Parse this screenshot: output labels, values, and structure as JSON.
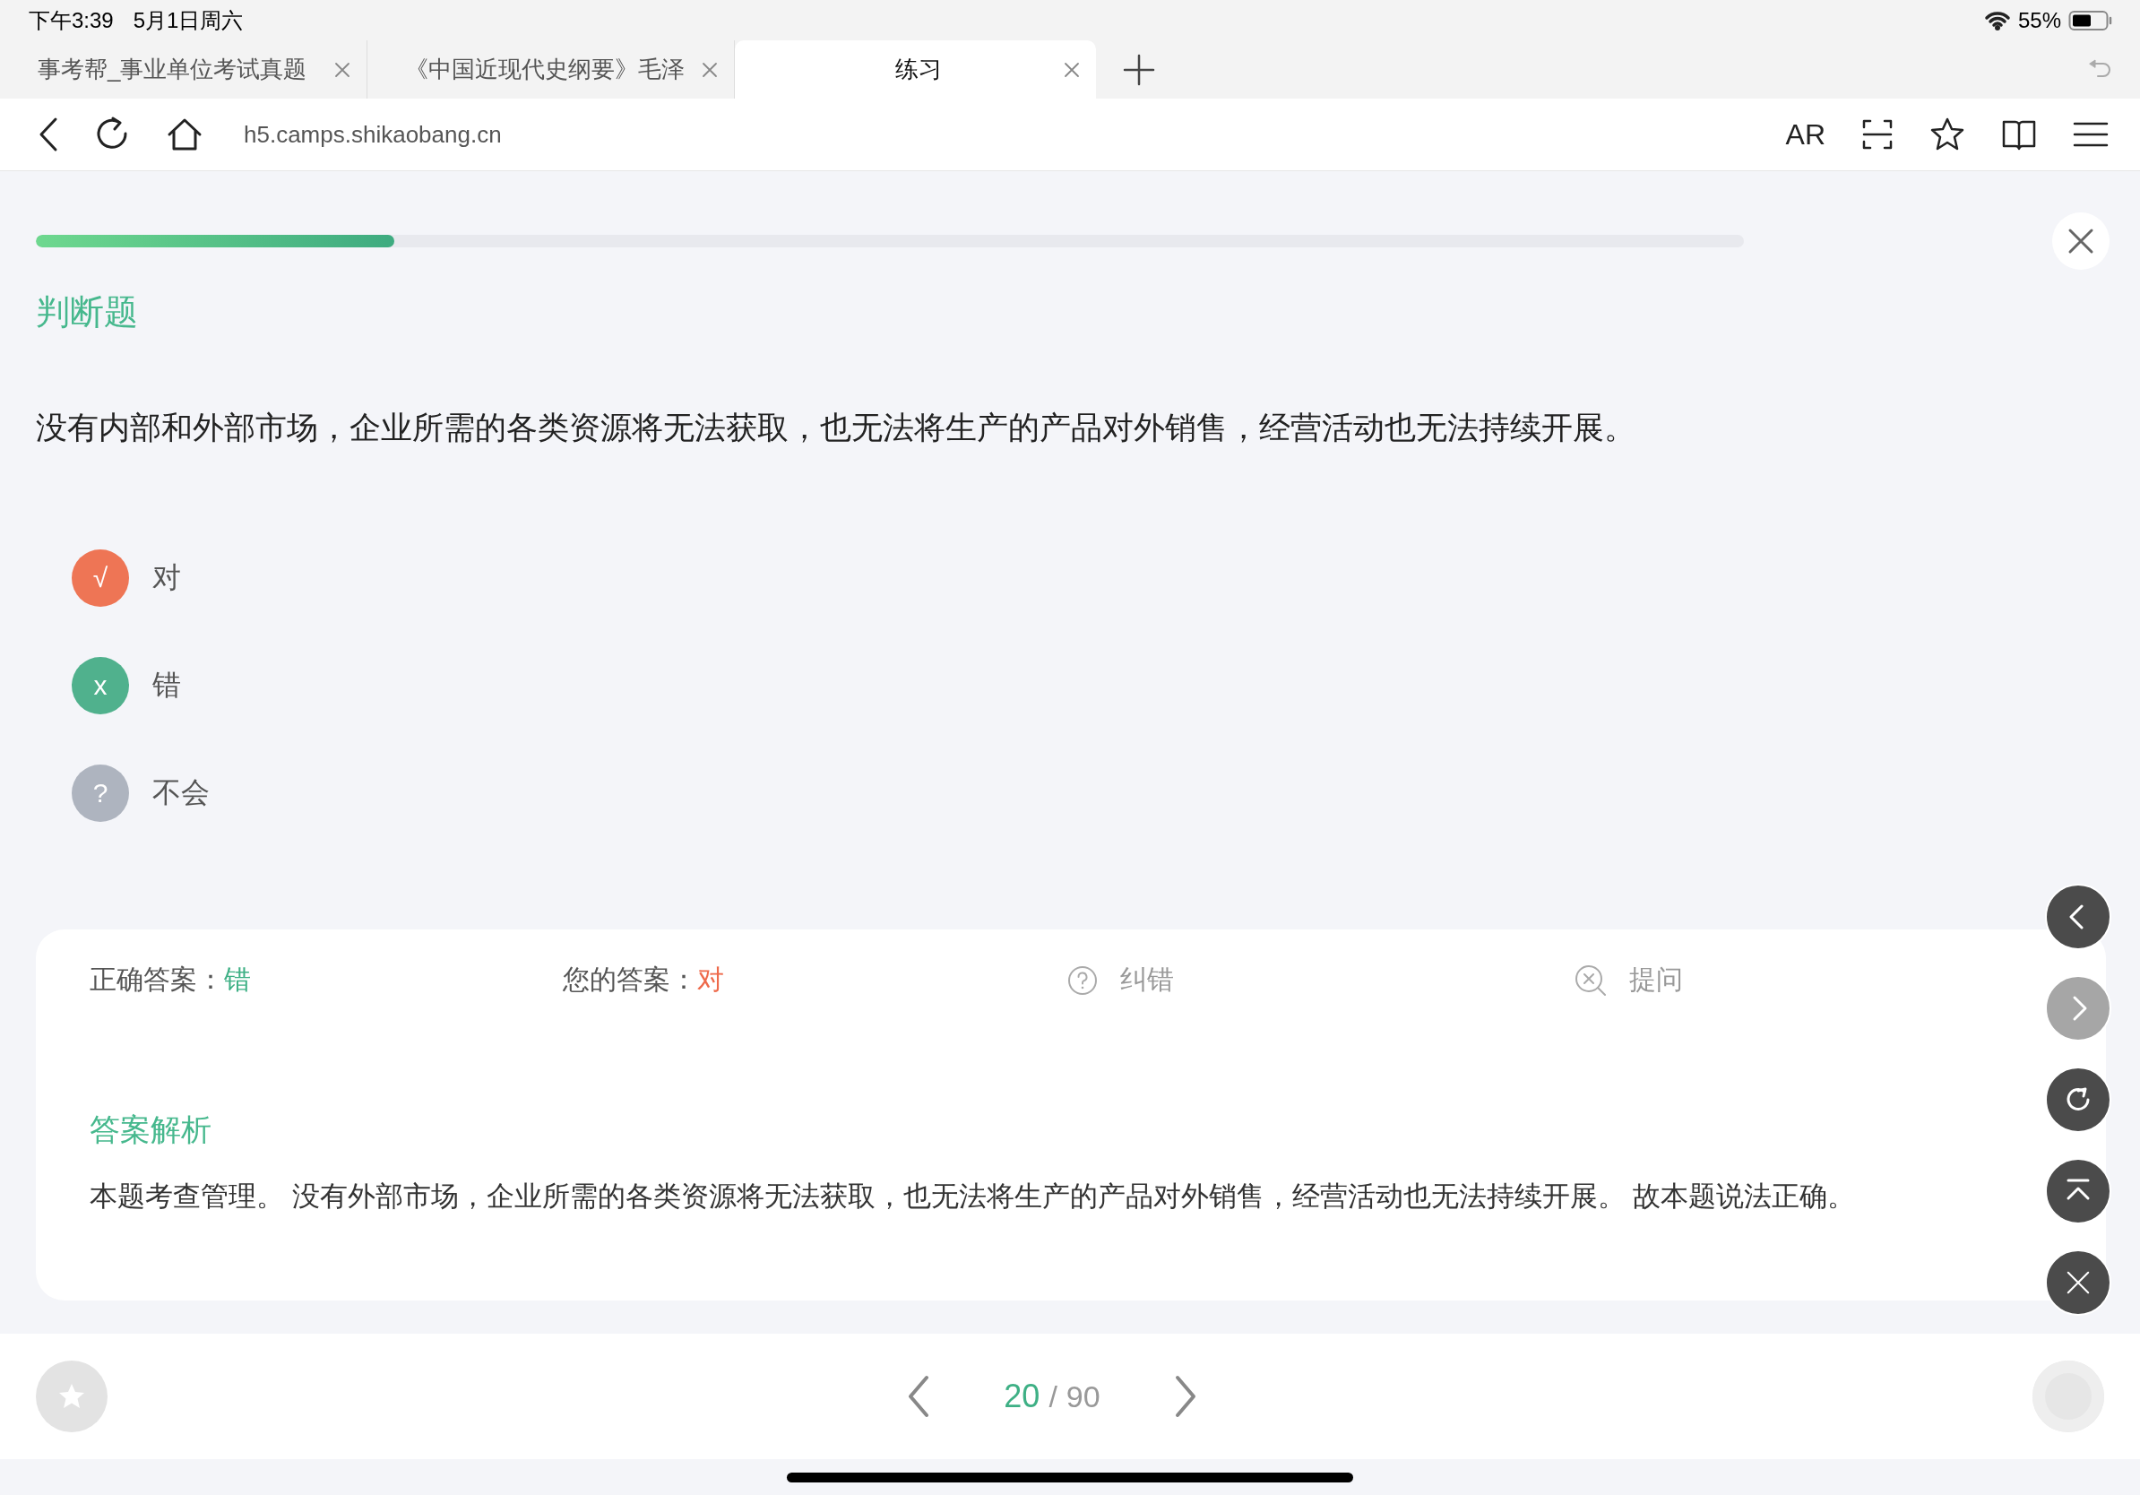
{
  "status_bar": {
    "time": "下午3:39",
    "date": "5月1日周六",
    "battery": "55%"
  },
  "tabs": [
    {
      "label": "事考帮_事业单位考试真题",
      "selected": false
    },
    {
      "label": "《中国近现代史纲要》毛泽",
      "selected": false
    },
    {
      "label": "练习",
      "selected": true
    }
  ],
  "address_bar": {
    "url": "h5.camps.shikaobang.cn",
    "ar": "AR"
  },
  "progress": {
    "level": 0.21
  },
  "question": {
    "type_label": "判断题",
    "text": "没有内部和外部市场，企业所需的各类资源将无法获取，也无法将生产的产品对外销售，经营活动也无法持续开展。"
  },
  "options": [
    {
      "mark": "√",
      "label": "对",
      "kind": "wrong"
    },
    {
      "mark": "x",
      "label": "错",
      "kind": "correct"
    },
    {
      "mark": "?",
      "label": "不会",
      "kind": "unsure"
    }
  ],
  "result": {
    "correct_label": "正确答案：",
    "correct_value": "错",
    "your_label": "您的答案：",
    "your_value": "对",
    "report": "纠错",
    "ask": "提问"
  },
  "analysis": {
    "title": "答案解析",
    "text": "本题考查管理。 没有外部市场，企业所需的各类资源将无法获取，也无法将生产的产品对外销售，经营活动也无法持续开展。 故本题说法正确。"
  },
  "float_buttons": [
    {
      "kind": "prev",
      "disabled": false
    },
    {
      "kind": "next",
      "disabled": true
    },
    {
      "kind": "refresh",
      "disabled": false
    },
    {
      "kind": "top",
      "disabled": false
    },
    {
      "kind": "close",
      "disabled": false
    }
  ],
  "pager": {
    "current": "20",
    "separator": "/",
    "total": "90"
  }
}
